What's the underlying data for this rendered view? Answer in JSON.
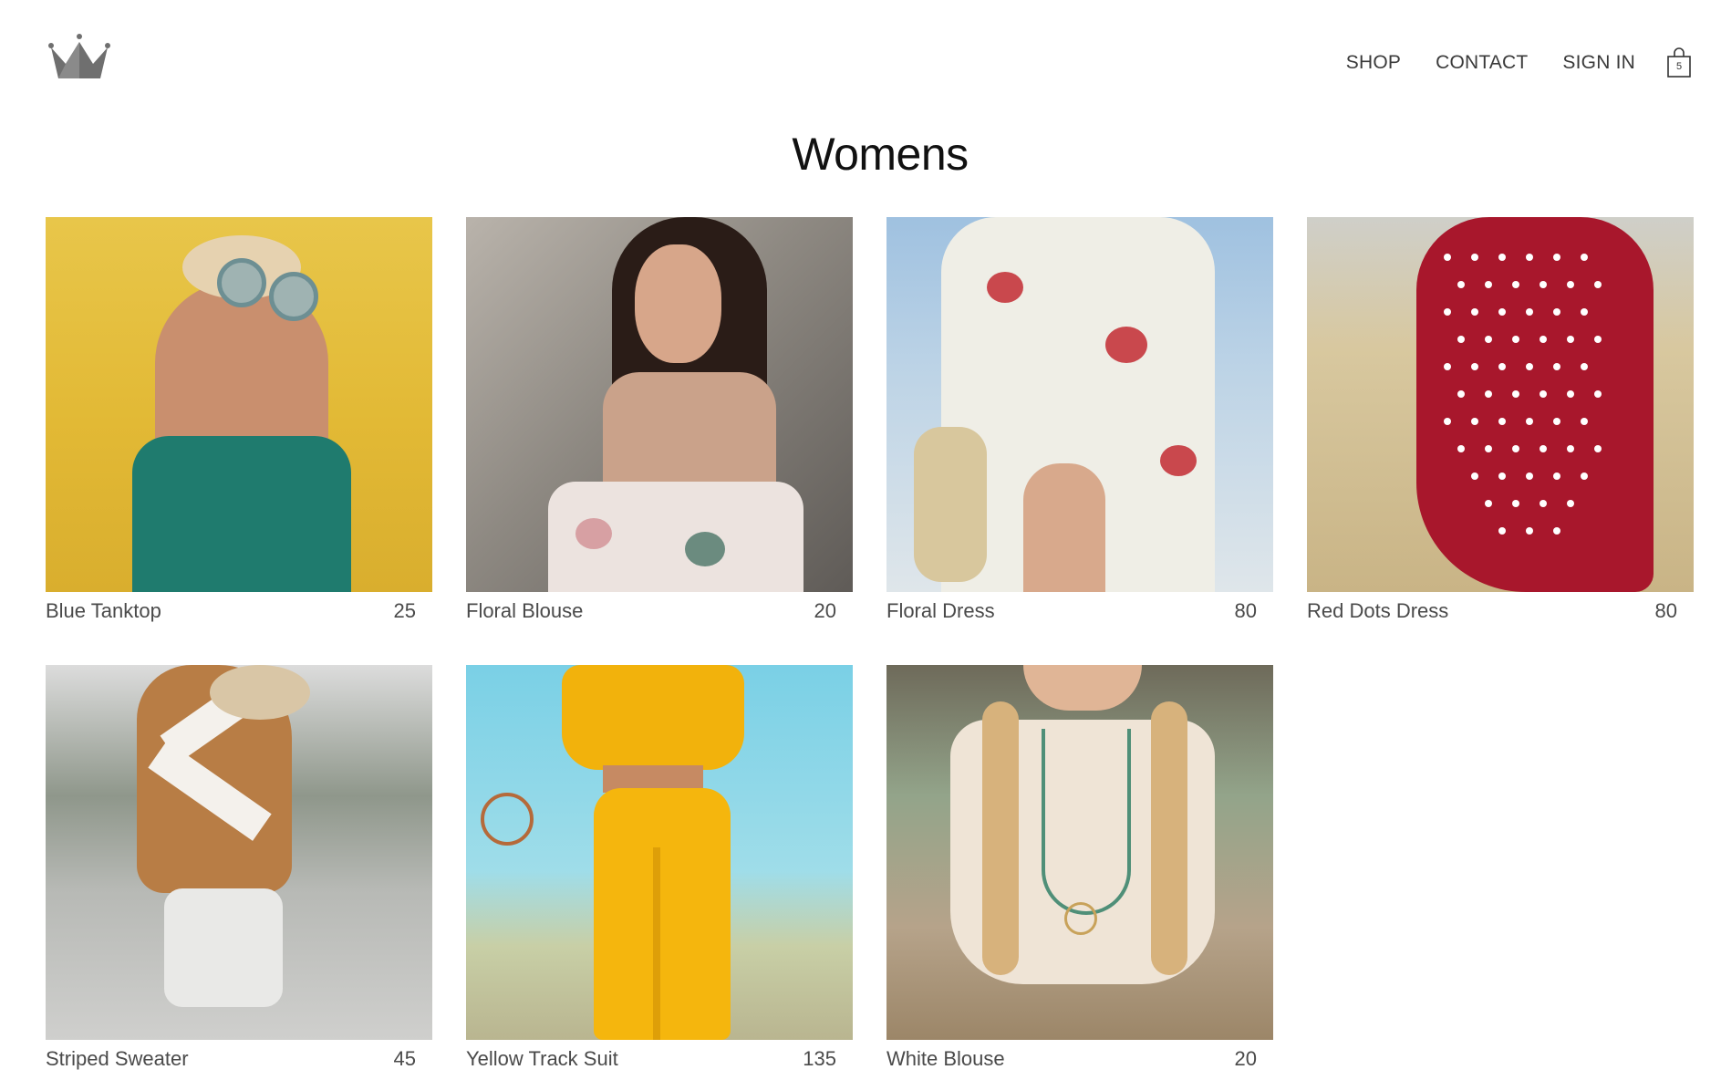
{
  "header": {
    "logo_icon": "crown-icon",
    "nav": [
      {
        "label": "SHOP"
      },
      {
        "label": "CONTACT"
      },
      {
        "label": "SIGN IN"
      }
    ],
    "cart": {
      "icon": "shopping-bag-icon",
      "count": "5"
    }
  },
  "main": {
    "title": "Womens",
    "products": [
      {
        "name": "Blue Tanktop",
        "price": "25"
      },
      {
        "name": "Floral Blouse",
        "price": "20"
      },
      {
        "name": "Floral Dress",
        "price": "80"
      },
      {
        "name": "Red Dots Dress",
        "price": "80"
      },
      {
        "name": "Striped Sweater",
        "price": "45"
      },
      {
        "name": "Yellow Track Suit",
        "price": "135"
      },
      {
        "name": "White Blouse",
        "price": "20"
      }
    ]
  },
  "colors": {
    "logo": "#6f6f6f",
    "text": "#4a4a4a",
    "title": "#111111"
  }
}
